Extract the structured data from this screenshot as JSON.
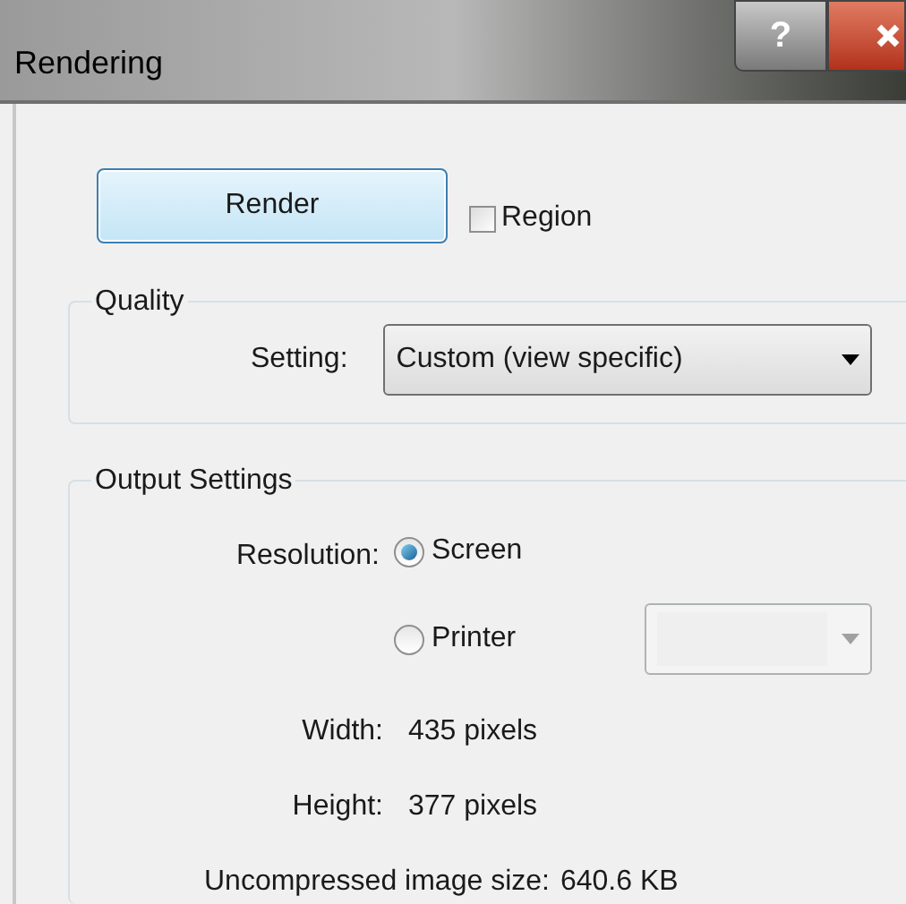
{
  "window": {
    "title": "Rendering",
    "help_button": "?"
  },
  "render_button": {
    "label": "Render"
  },
  "region_checkbox": {
    "label": "Region",
    "checked": false
  },
  "quality": {
    "title": "Quality",
    "setting_label": "Setting:",
    "setting_value": "Custom (view specific)"
  },
  "output_settings": {
    "title": "Output Settings",
    "resolution_label": "Resolution:",
    "resolution_options": [
      {
        "label": "Screen",
        "selected": true
      },
      {
        "label": "Printer",
        "selected": false
      }
    ],
    "printer_dropdown": {
      "disabled": true
    },
    "info": [
      {
        "label": "Width:",
        "value": "435 pixels"
      },
      {
        "label": "Height:",
        "value": "377 pixels"
      }
    ],
    "image_size": {
      "label": "Uncompressed image size:",
      "value": "640.6 KB"
    }
  }
}
